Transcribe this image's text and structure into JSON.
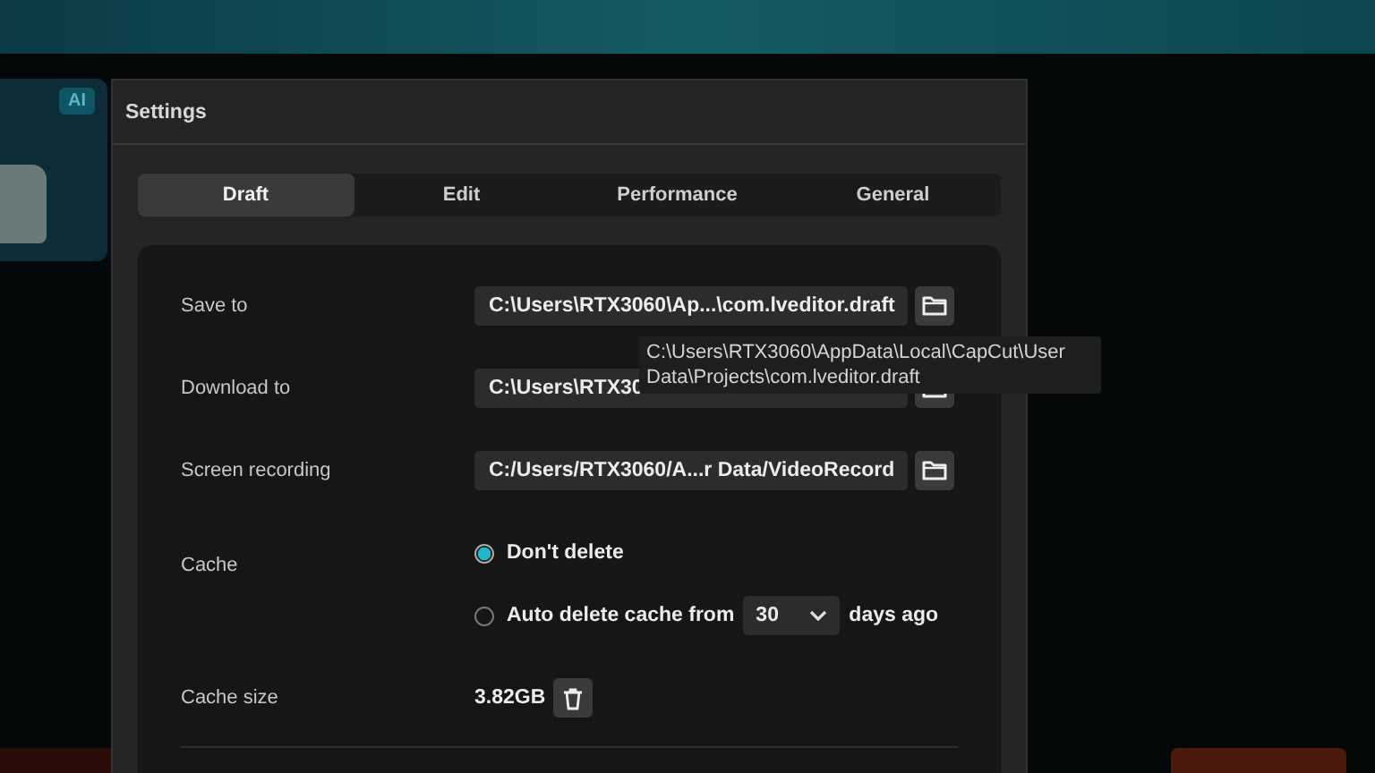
{
  "background": {
    "badge": "AI"
  },
  "window": {
    "title": "Settings"
  },
  "tabs": [
    {
      "label": "Draft",
      "selected": true
    },
    {
      "label": "Edit",
      "selected": false
    },
    {
      "label": "Performance",
      "selected": false
    },
    {
      "label": "General",
      "selected": false
    }
  ],
  "paths": [
    {
      "label": "Save to",
      "value": "C:\\Users\\RTX3060\\Ap...\\com.lveditor.draft"
    },
    {
      "label": "Download to",
      "value": "C:\\Users\\RTX30"
    },
    {
      "label": "Screen recording",
      "value": "C:/Users/RTX3060/A...r Data/VideoRecord"
    }
  ],
  "tooltip": "C:\\Users\\RTX3060\\AppData\\Local\\CapCut\\User Data\\Projects\\com.lveditor.draft",
  "cache": {
    "label": "Cache",
    "options": [
      {
        "kind": "plain",
        "label": "Don't delete",
        "selected": true
      },
      {
        "kind": "days",
        "label": "Auto delete cache from",
        "value": "30",
        "suffix": "days ago",
        "selected": false
      }
    ]
  },
  "cache_size": {
    "label": "Cache size",
    "value": "3.82GB"
  }
}
